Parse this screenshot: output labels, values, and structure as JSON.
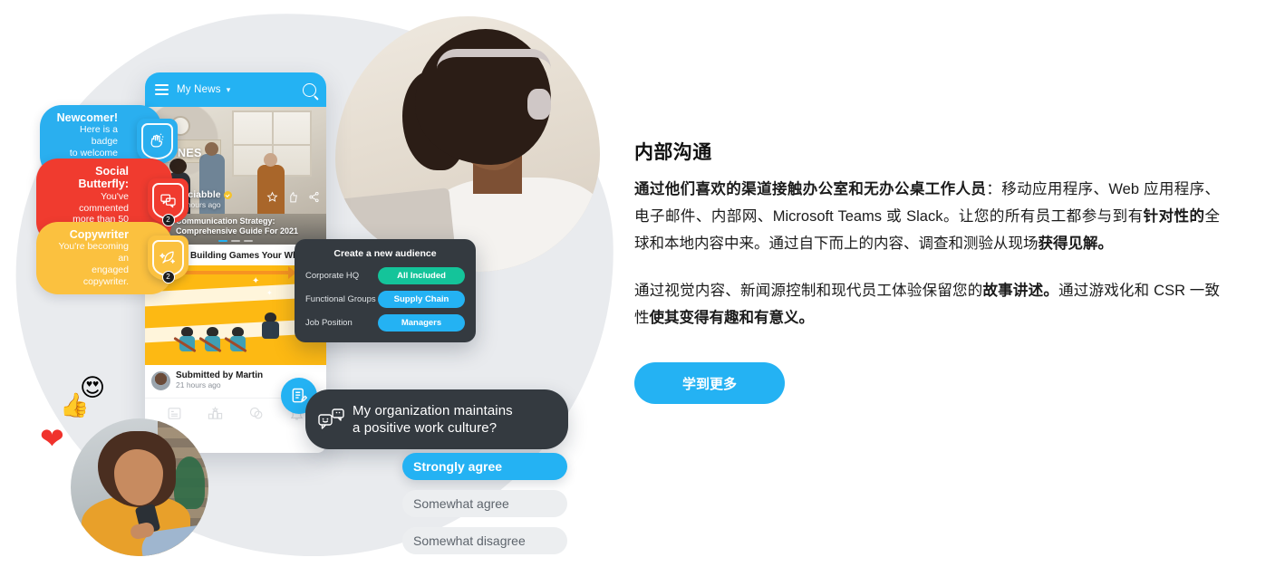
{
  "content": {
    "heading": "内部沟通",
    "paragraph1_lead": "通过他们喜欢的渠道接触办公室和无办公桌工作人员",
    "paragraph1_mid": "：移动应用程序、Web 应用程序、电子邮件、内部网、Microsoft Teams 或 Slack。让您的所有员工都参与到有",
    "paragraph1_bold2": "针对性的",
    "paragraph1_mid2": "全球和本地内容中来。通过自下而上的内容、调查和测验从现场",
    "paragraph1_bold3": "获得见解。",
    "paragraph2_start": "通过视觉内容、新闻源控制和现代员工体验保留您的",
    "paragraph2_bold1": "故事讲述。",
    "paragraph2_mid": "通过游戏化和 CSR 一致性",
    "paragraph2_bold2": "使其变得有趣和有意义。",
    "cta_label": "学到更多"
  },
  "colors": {
    "accent_blue": "#24b2f3",
    "panel_dark": "#343a40",
    "chip_green": "#14c49a",
    "badge_blue": "#2aafef",
    "badge_red": "#f03b2f",
    "badge_yellow": "#fbc13f",
    "blob_gray": "#e9ebee",
    "text_dark": "#1b1b1b"
  },
  "phone": {
    "nav_title": "My News",
    "hero_overlay_text": "NES",
    "post": {
      "author": "Sociabble",
      "time": "21 hours ago",
      "title_line1": "Communication Strategy:",
      "title_line2": "Comprehensive Guide For 2021"
    },
    "article_headline": "32 Team Building Games Your Wh",
    "submitted": {
      "label": "Submitted by Martin",
      "time": "21 hours ago"
    },
    "bottom_nav": [
      "feed-icon",
      "leaderboard-icon",
      "chat-icon",
      "bell-icon"
    ],
    "post_actions": [
      "star-icon",
      "like-icon",
      "share-icon"
    ]
  },
  "badges": [
    {
      "id": "newcomer",
      "title": "Newcomer!",
      "line1": "Here is a badge",
      "line2": "to welcome you.",
      "color": "#2aafef",
      "icon": "clapping-hands-icon",
      "glyph": "👏",
      "count": ""
    },
    {
      "id": "social-butterfly",
      "title": "Social Butterfly:",
      "line1": "You've commented",
      "line2": "more than 50 posts!",
      "color": "#f03b2f",
      "icon": "chat-bubbles-icon",
      "glyph": "⌨",
      "count": "2"
    },
    {
      "id": "copywriter",
      "title": "Copywriter",
      "line1": "You're becoming an",
      "line2": "engaged copywriter.",
      "color": "#fbc13f",
      "icon": "quill-sparkle-icon",
      "glyph": "✦",
      "count": "2"
    }
  ],
  "audience_panel": {
    "title": "Create a new audience",
    "rows": [
      {
        "label": "Corporate HQ",
        "chip": "All Included",
        "chip_color": "#14c49a"
      },
      {
        "label": "Functional Groups",
        "chip": "Supply Chain",
        "chip_color": "#24b2f3"
      },
      {
        "label": "Job Position",
        "chip": "Managers",
        "chip_color": "#24b2f3"
      }
    ]
  },
  "survey": {
    "question_line1": "My organization maintains",
    "question_line2": "a positive work culture?",
    "answers": [
      {
        "label": "Strongly agree",
        "selected": true
      },
      {
        "label": "Somewhat agree",
        "selected": false
      },
      {
        "label": "Somewhat disagree",
        "selected": false
      }
    ]
  },
  "reactions": [
    {
      "name": "thumbs-up-reaction",
      "glyph": "👍"
    },
    {
      "name": "heart-eyes-reaction",
      "glyph": "😍"
    },
    {
      "name": "heart-reaction",
      "glyph": "❤"
    }
  ]
}
